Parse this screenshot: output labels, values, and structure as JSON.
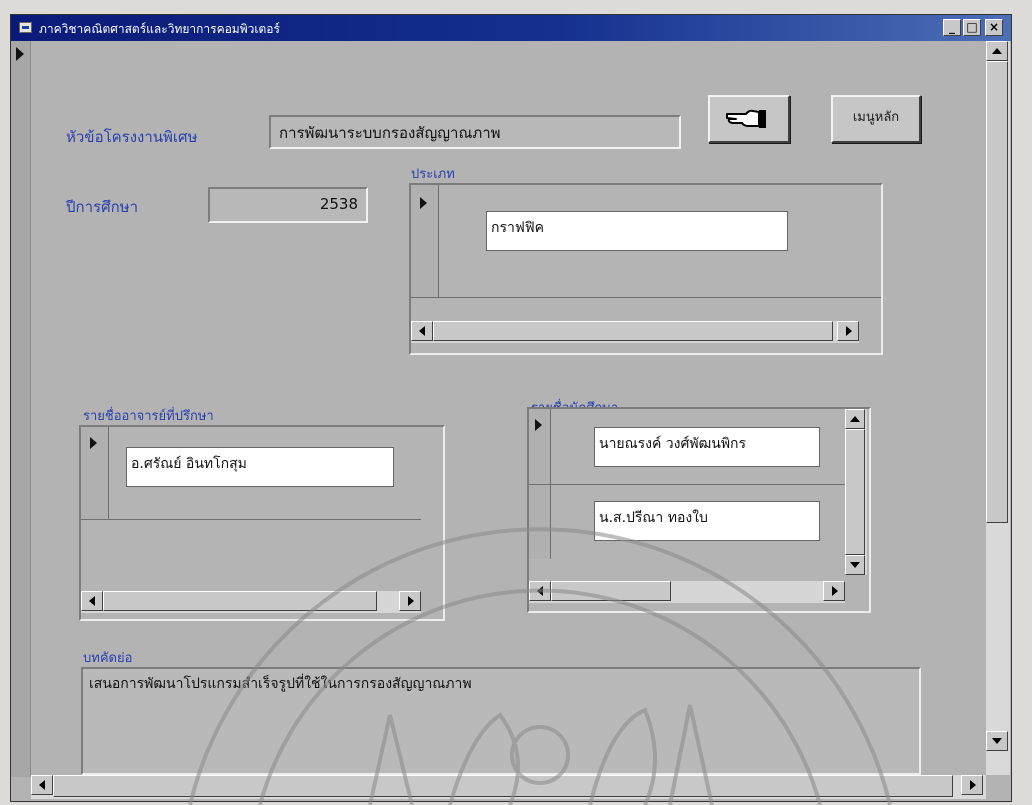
{
  "window": {
    "title": "ภาควิชาคณิตศาสตร์และวิทยาการคอมพิวเตอร์",
    "controls": [
      "_",
      "□",
      "×"
    ]
  },
  "form": {
    "project_title_label": "หัวข้อโครงงานพิเศษ",
    "project_title_value": "การพัฒนาระบบกรองสัญญาณภาพ",
    "academic_year_label": "ปีการศึกษา",
    "academic_year_value": "2538",
    "category_label": "ประเภท",
    "category_rows": [
      "กราฟฟิค"
    ],
    "advisor_label": "รายชื่ออาจารย์ที่ปรึกษา",
    "advisor_rows": [
      "อ.ศรัณย์ อินทโกสุม"
    ],
    "students_label": "รายชื่อนักศึกษา",
    "student_rows": [
      "นายณรงค์ วงศ์พัฒนพิกร",
      "น.ส.ปรีณา ทองใบ"
    ],
    "abstract_label": "บทคัดย่อ",
    "abstract_value": "เสนอการพัฒนาโปรแกรมสำเร็จรูปที่ใช้ในการกรองสัญญาณภาพ"
  },
  "buttons": {
    "next_icon": "pointing-hand-icon",
    "main_menu_label": "เมนูหลัก"
  },
  "colors": {
    "titlebar": "#0a1a78",
    "label_blue": "#2a3fae",
    "form_background": "#b3b3b3"
  }
}
